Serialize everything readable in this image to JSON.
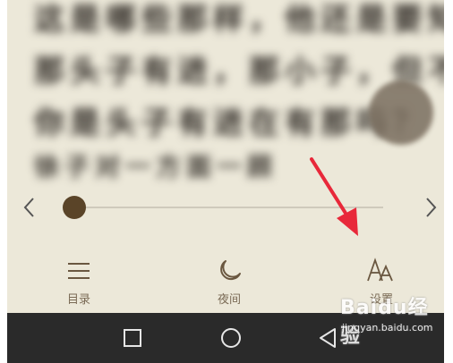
{
  "reading": {
    "lines": [
      "这是哪些那样，他还是要知道",
      "那头子有进，那小子，但不说",
      "你是头子有进在有那吗？",
      "徐子对一方面一顾"
    ]
  },
  "slider": {
    "prev_icon": "chevron-left-icon",
    "next_icon": "chevron-right-icon",
    "progress": 0.02
  },
  "menu": {
    "items": [
      {
        "label": "目录",
        "icon": "list-icon"
      },
      {
        "label": "夜间",
        "icon": "moon-icon"
      },
      {
        "label": "设置",
        "icon": "font-size-icon"
      }
    ]
  },
  "navbar": {
    "icons": [
      "recent-apps-icon",
      "home-icon",
      "back-icon"
    ]
  },
  "watermark": {
    "brand": "Baidu经验",
    "url": "jingyan.baidu.com"
  },
  "colors": {
    "background": "#ece8d9",
    "thumb": "#5a4428",
    "icon": "#6a5740",
    "arrow": "#e8283a",
    "navbar": "#2a2a2a"
  }
}
